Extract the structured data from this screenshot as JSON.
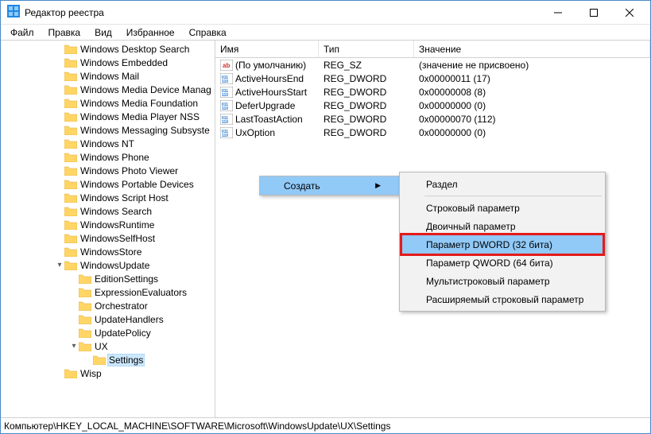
{
  "window": {
    "title": "Редактор реестра"
  },
  "menubar": {
    "items": [
      "Файл",
      "Правка",
      "Вид",
      "Избранное",
      "Справка"
    ]
  },
  "tree": [
    {
      "label": "Windows Desktop Search",
      "indent": 0,
      "toggle": ""
    },
    {
      "label": "Windows Embedded",
      "indent": 0,
      "toggle": ""
    },
    {
      "label": "Windows Mail",
      "indent": 0,
      "toggle": ""
    },
    {
      "label": "Windows Media Device Manag",
      "indent": 0,
      "toggle": ""
    },
    {
      "label": "Windows Media Foundation",
      "indent": 0,
      "toggle": ""
    },
    {
      "label": "Windows Media Player NSS",
      "indent": 0,
      "toggle": ""
    },
    {
      "label": "Windows Messaging Subsyste",
      "indent": 0,
      "toggle": ""
    },
    {
      "label": "Windows NT",
      "indent": 0,
      "toggle": ""
    },
    {
      "label": "Windows Phone",
      "indent": 0,
      "toggle": ""
    },
    {
      "label": "Windows Photo Viewer",
      "indent": 0,
      "toggle": ""
    },
    {
      "label": "Windows Portable Devices",
      "indent": 0,
      "toggle": ""
    },
    {
      "label": "Windows Script Host",
      "indent": 0,
      "toggle": ""
    },
    {
      "label": "Windows Search",
      "indent": 0,
      "toggle": ""
    },
    {
      "label": "WindowsRuntime",
      "indent": 0,
      "toggle": ""
    },
    {
      "label": "WindowsSelfHost",
      "indent": 0,
      "toggle": ""
    },
    {
      "label": "WindowsStore",
      "indent": 0,
      "toggle": ""
    },
    {
      "label": "WindowsUpdate",
      "indent": 0,
      "toggle": "▾"
    },
    {
      "label": "EditionSettings",
      "indent": 1,
      "toggle": ""
    },
    {
      "label": "ExpressionEvaluators",
      "indent": 1,
      "toggle": ""
    },
    {
      "label": "Orchestrator",
      "indent": 1,
      "toggle": ""
    },
    {
      "label": "UpdateHandlers",
      "indent": 1,
      "toggle": ""
    },
    {
      "label": "UpdatePolicy",
      "indent": 1,
      "toggle": ""
    },
    {
      "label": "UX",
      "indent": 1,
      "toggle": "▾"
    },
    {
      "label": "Settings",
      "indent": 2,
      "toggle": "",
      "selected": true
    },
    {
      "label": "Wisp",
      "indent": 0,
      "toggle": ""
    }
  ],
  "list": {
    "headers": {
      "name": "Имя",
      "type": "Тип",
      "value": "Значение"
    },
    "rows": [
      {
        "icon": "sz",
        "name": "(По умолчанию)",
        "type": "REG_SZ",
        "value": "(значение не присвоено)"
      },
      {
        "icon": "bin",
        "name": "ActiveHoursEnd",
        "type": "REG_DWORD",
        "value": "0x00000011 (17)"
      },
      {
        "icon": "bin",
        "name": "ActiveHoursStart",
        "type": "REG_DWORD",
        "value": "0x00000008 (8)"
      },
      {
        "icon": "bin",
        "name": "DeferUpgrade",
        "type": "REG_DWORD",
        "value": "0x00000000 (0)"
      },
      {
        "icon": "bin",
        "name": "LastToastAction",
        "type": "REG_DWORD",
        "value": "0x00000070 (112)"
      },
      {
        "icon": "bin",
        "name": "UxOption",
        "type": "REG_DWORD",
        "value": "0x00000000 (0)"
      }
    ]
  },
  "context": {
    "create": "Создать",
    "types": [
      {
        "label": "Раздел",
        "sep_after": true
      },
      {
        "label": "Строковый параметр"
      },
      {
        "label": "Двоичный параметр"
      },
      {
        "label": "Параметр DWORD (32 бита)",
        "highlighted": true,
        "hover": true
      },
      {
        "label": "Параметр QWORD (64 бита)"
      },
      {
        "label": "Мультистроковый параметр"
      },
      {
        "label": "Расширяемый строковый параметр"
      }
    ]
  },
  "statusbar": {
    "path": "Компьютер\\HKEY_LOCAL_MACHINE\\SOFTWARE\\Microsoft\\WindowsUpdate\\UX\\Settings"
  }
}
